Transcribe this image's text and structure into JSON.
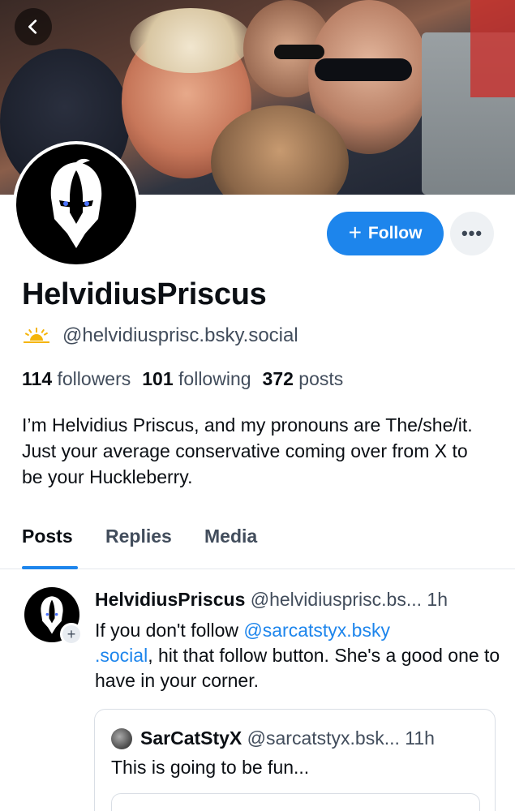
{
  "profile": {
    "display_name": "HelvidiusPriscus",
    "handle": "@helvidiusprisc.bsky.social",
    "followers_count": "114",
    "followers_label": "followers",
    "following_count": "101",
    "following_label": "following",
    "posts_count": "372",
    "posts_label": "posts",
    "bio": "I’m Helvidius Priscus, and my pronouns are The/she/it. Just your average conservative coming over from X to be your Huckleberry.",
    "follow_label": "Follow",
    "more_label": "•••"
  },
  "tabs": [
    {
      "label": "Posts",
      "active": true
    },
    {
      "label": "Replies",
      "active": false
    },
    {
      "label": "Media",
      "active": false
    }
  ],
  "post": {
    "author_name": "HelvidiusPriscus",
    "author_handle": "@helvidiusprisc.bs...",
    "time": "1h",
    "text_before": "If you don't follow ",
    "mention": "@sarcatstyx.bsky\n.social",
    "text_after": ", hit that follow button. She's a good one to have in your corner.",
    "quote": {
      "author_name": "SarCatStyX",
      "author_handle": "@sarcatstyx.bsk...",
      "time": "11h",
      "text": "This is going to be fun..."
    }
  },
  "colors": {
    "accent": "#1d85ec",
    "muted_text": "#424d5c",
    "handle_emoji": "#f5b50a"
  },
  "icons": {
    "back": "chevron-left-icon",
    "plus": "plus-icon",
    "more": "ellipsis-icon",
    "sun_emoji": "sunrise-icon"
  }
}
